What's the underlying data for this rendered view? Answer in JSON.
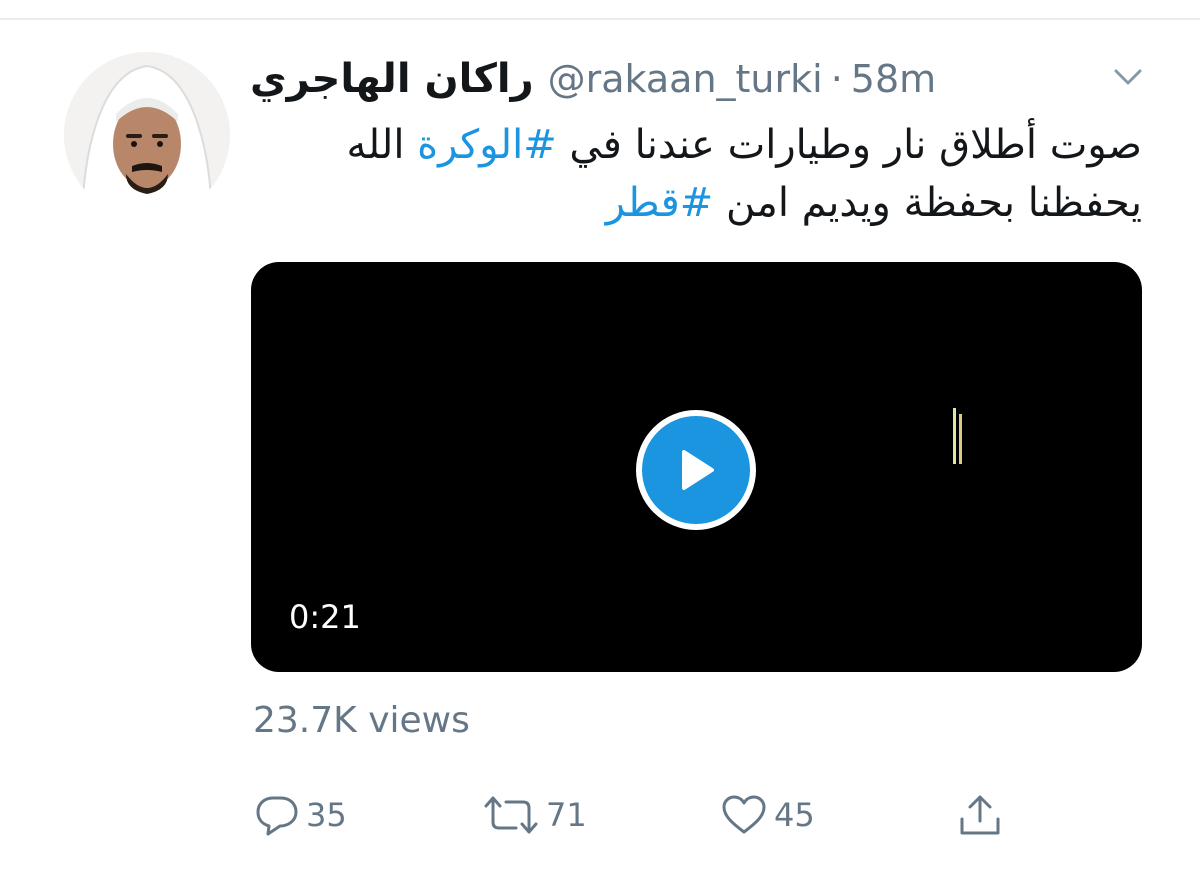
{
  "tweet": {
    "display_name": "راكان الهاجري",
    "handle": "@rakaan_turki",
    "separator": "·",
    "time": "58m",
    "text_line1_pre": "صوت أطلاق نار وطيارات عندنا في ",
    "hashtag1": "#الوكرة",
    "text_line1_post": " الله",
    "text_line2_pre": "يحفظنا بحفظة ويديم امن ",
    "hashtag2": "#قطر",
    "video_duration": "0:21",
    "views": "23.7K views",
    "replies": "35",
    "retweets": "71",
    "likes": "45"
  },
  "icons": {
    "caret": "chevron-down-icon",
    "reply": "reply-icon",
    "retweet": "retweet-icon",
    "like": "heart-icon",
    "share": "share-icon",
    "play": "play-icon"
  },
  "colors": {
    "accent": "#1b95e0",
    "muted": "#657786",
    "text": "#14171a"
  }
}
